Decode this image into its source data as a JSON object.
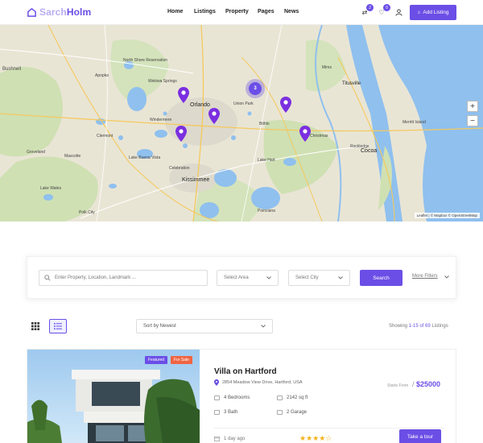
{
  "brand": {
    "name_part1": "Sarch",
    "name_part2": "Holm",
    "accent": "#6b4ee6"
  },
  "nav": [
    "Home",
    "Listings",
    "Property",
    "Pages",
    "News"
  ],
  "header_icons": [
    {
      "name": "compare-icon",
      "badge": "2"
    },
    {
      "name": "heart-icon",
      "badge": "0"
    },
    {
      "name": "user-icon",
      "badge": null
    }
  ],
  "add_listing_label": "Add Listing",
  "map": {
    "cities": [
      "Orlando",
      "Kissimmee",
      "Cocoa",
      "Titusville",
      "Bushnell"
    ],
    "places": [
      "North Shore Reservation",
      "Windermere",
      "Wekiwa Springs",
      "Clermont",
      "Lake Wales",
      "Celebration",
      "Poinciana",
      "Polk City",
      "Lake Hart",
      "Rockledge",
      "Mims",
      "Christmas",
      "Bithlo",
      "Union Park",
      "Apopka",
      "Groveland",
      "Mascotte",
      "Lake Buena Vista",
      "Merritt Island"
    ],
    "roads": [
      "50",
      "429",
      "528",
      "441",
      "27",
      "417",
      "520",
      "95",
      "92",
      "17",
      "60"
    ],
    "cluster_count": "3",
    "zoom_in": "+",
    "zoom_out": "−",
    "attribution": "Leaflet | © Mapbox © OpenStreetMap"
  },
  "search": {
    "placeholder": "Enter Property, Location, Landmark ...",
    "area_label": "Select Area",
    "city_label": "Select City",
    "button": "Search",
    "more_filters": "More Filters"
  },
  "toolbar": {
    "sort_label": "Sort by Newest",
    "showing_prefix": "Showing",
    "showing_range": "1-15 of 69",
    "showing_suffix": "Listings"
  },
  "listing": {
    "tags": [
      "Featured",
      "For Sale"
    ],
    "tag_colors": [
      "#6b4ee6",
      "#f06543"
    ],
    "title": "Villa on Hartford",
    "address": "2854 Meadow View Drive, Hartford, USA",
    "price_prefix": "Starts From",
    "price_sep": "/",
    "price": "$25000",
    "features": [
      "4 Bedrooms",
      "2142 sq ft",
      "3 Bath",
      "2 Garage"
    ],
    "posted": "1 day ago",
    "rating": 3.5,
    "stars": "★★★★☆",
    "cta": "Take a tour"
  }
}
